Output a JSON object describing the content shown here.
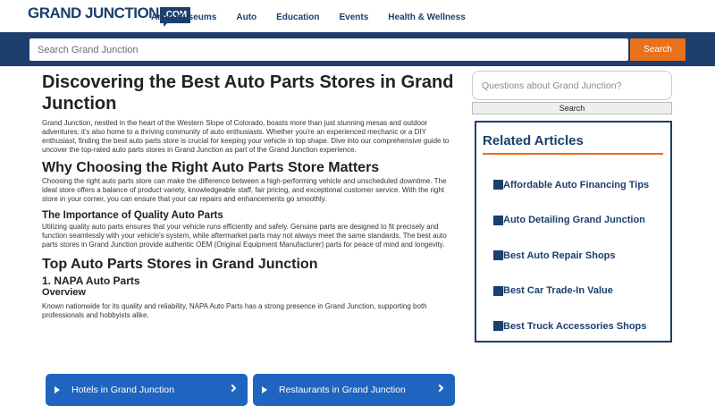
{
  "header": {
    "logo_main": "GRAND JUNCTION",
    "logo_box": ".COM",
    "nav": [
      "Art & Museums",
      "Auto",
      "Education",
      "Events",
      "Health & Wellness"
    ]
  },
  "search": {
    "placeholder": "Search Grand Junction",
    "button": "Search"
  },
  "article": {
    "title": "Discovering the Best Auto Parts Stores in Grand Junction",
    "intro": "Grand Junction, nestled in the heart of the Western Slope of Colorado, boasts more than just stunning mesas and outdoor adventures; it's also home to a thriving community of auto enthusiasts. Whether you're an experienced mechanic or a DIY enthusiast, finding the best auto parts store is crucial for keeping your vehicle in top shape. Dive into our comprehensive guide to uncover the top-rated auto parts stores in Grand Junction as part of the Grand Junction experience.",
    "h2_choosing": "Why Choosing the Right Auto Parts Store Matters",
    "p_choosing": "Choosing the right auto parts store can make the difference between a high-performing vehicle and unscheduled downtime. The ideal store offers a balance of product variety, knowledgeable staff, fair pricing, and exceptional customer service. With the right store in your corner, you can ensure that your car repairs and enhancements go smoothly.",
    "h3_quality": "The Importance of Quality Auto Parts",
    "p_quality": "Utilizing quality auto parts ensures that your vehicle runs efficiently and safely. Genuine parts are designed to fit precisely and function seamlessly with your vehicle's system, while aftermarket parts may not always meet the same standards. The best auto parts stores in Grand Junction provide authentic OEM (Original Equipment Manufacturer) parts for peace of mind and longevity.",
    "h2_top": "Top Auto Parts Stores in Grand Junction",
    "h3_napa": "1. NAPA Auto Parts",
    "h4_overview": "Overview",
    "p_napa": "Known nationwide for its quality and reliability, NAPA Auto Parts has a strong presence in Grand Junction, supporting both professionals and hobbyists alike."
  },
  "sidebar": {
    "ask_placeholder": "Questions about Grand Junction?",
    "ask_button": "Search",
    "related_title": "Related Articles",
    "related": [
      "Affordable Auto Financing Tips",
      "Auto Detailing Grand Junction",
      "Best Auto Repair Shops",
      "Best Car Trade-In Value",
      "Best Truck Accessories Shops"
    ]
  },
  "bottom_buttons": {
    "hotels": "Hotels in Grand Junction",
    "restaurants": "Restaurants in Grand Junction"
  },
  "colors": {
    "navy": "#1c3f6e",
    "orange": "#e8711c",
    "button_blue": "#1f64bf"
  }
}
